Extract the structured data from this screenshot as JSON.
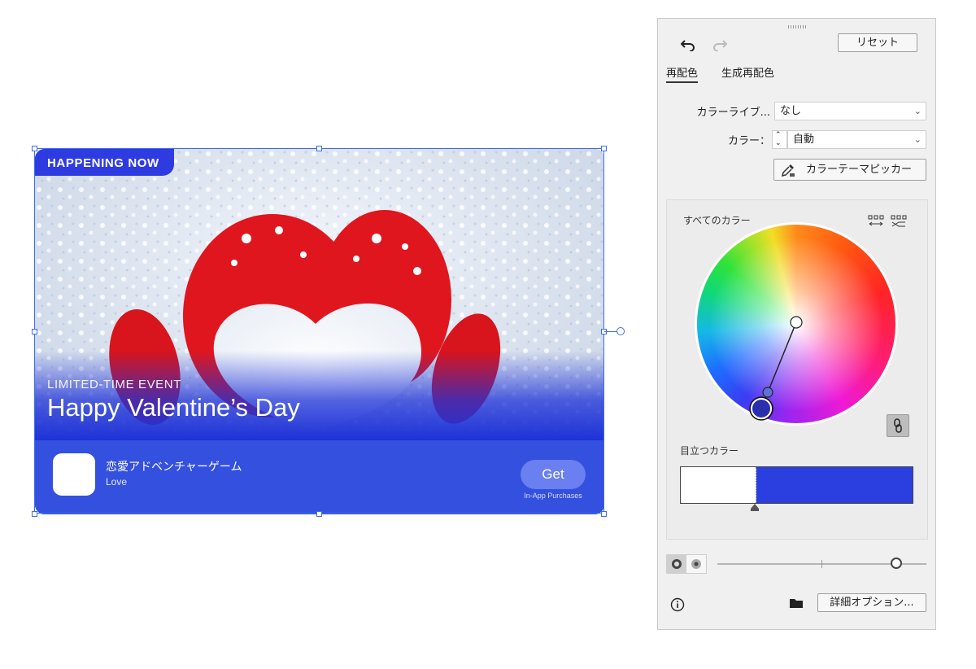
{
  "card": {
    "badge": "HAPPENING NOW",
    "kicker": "LIMITED-TIME EVENT",
    "title": "Happy Valentine’s Day",
    "app_name": "恋愛アドベンチャーゲーム",
    "app_subtitle": "Love",
    "get_label": "Get",
    "iap_label": "In-App Purchases",
    "colors": {
      "accent": "#2e3be0",
      "bottom_bar": "#3450df",
      "get_button": "#6a7ff0"
    }
  },
  "panel": {
    "reset_label": "リセット",
    "tabs": [
      {
        "label": "再配色",
        "active": true
      },
      {
        "label": "生成再配色",
        "active": false
      }
    ],
    "library_label": "カラーライブ...",
    "library_value": "なし",
    "colors_label": "カラー：",
    "colors_value": "自動",
    "picker_label": "カラーテーマピッカー",
    "all_colors_label": "すべてのカラー",
    "prominent_label": "目立つカラー",
    "prominent_colors": [
      "#ffffff",
      "#2b3ee0"
    ],
    "advanced_label": "詳細オプション..."
  }
}
